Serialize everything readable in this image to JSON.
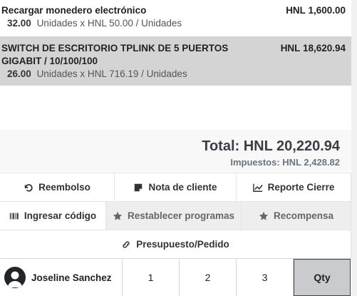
{
  "order_lines": [
    {
      "name": "Recargar monedero electrónico",
      "price": "HNL 1,600.00",
      "qty": "32.00",
      "info": "Unidades x HNL 50.00 / Unidades",
      "selected": false
    },
    {
      "name": "SWITCH DE ESCRITORIO TPLINK DE 5 PUERTOS GIGABIT / 10/100/100",
      "price": "HNL 18,620.94",
      "qty": "26.00",
      "info": "Unidades x HNL 716.19 / Unidades",
      "selected": true
    }
  ],
  "summary": {
    "total": "Total: HNL 20,220.94",
    "taxes": "Impuestos: HNL 2,428.82"
  },
  "controls": {
    "refund": "Reembolso",
    "customer_note": "Nota de cliente",
    "close_report": "Reporte Cierre",
    "enter_code": "Ingresar código",
    "reset_programs": "Restablecer programas",
    "reward": "Recompensa",
    "quote_order": "Presupuesto/Pedido"
  },
  "customer": {
    "name": "Joseline Sanchez"
  },
  "numpad": {
    "k1": "1",
    "k2": "2",
    "k3": "3",
    "qty": "Qty"
  },
  "colors": {
    "selected_line": "#d4d4d4",
    "summary_bg": "#f8f8f9",
    "muted_button": "#eeeeee"
  }
}
